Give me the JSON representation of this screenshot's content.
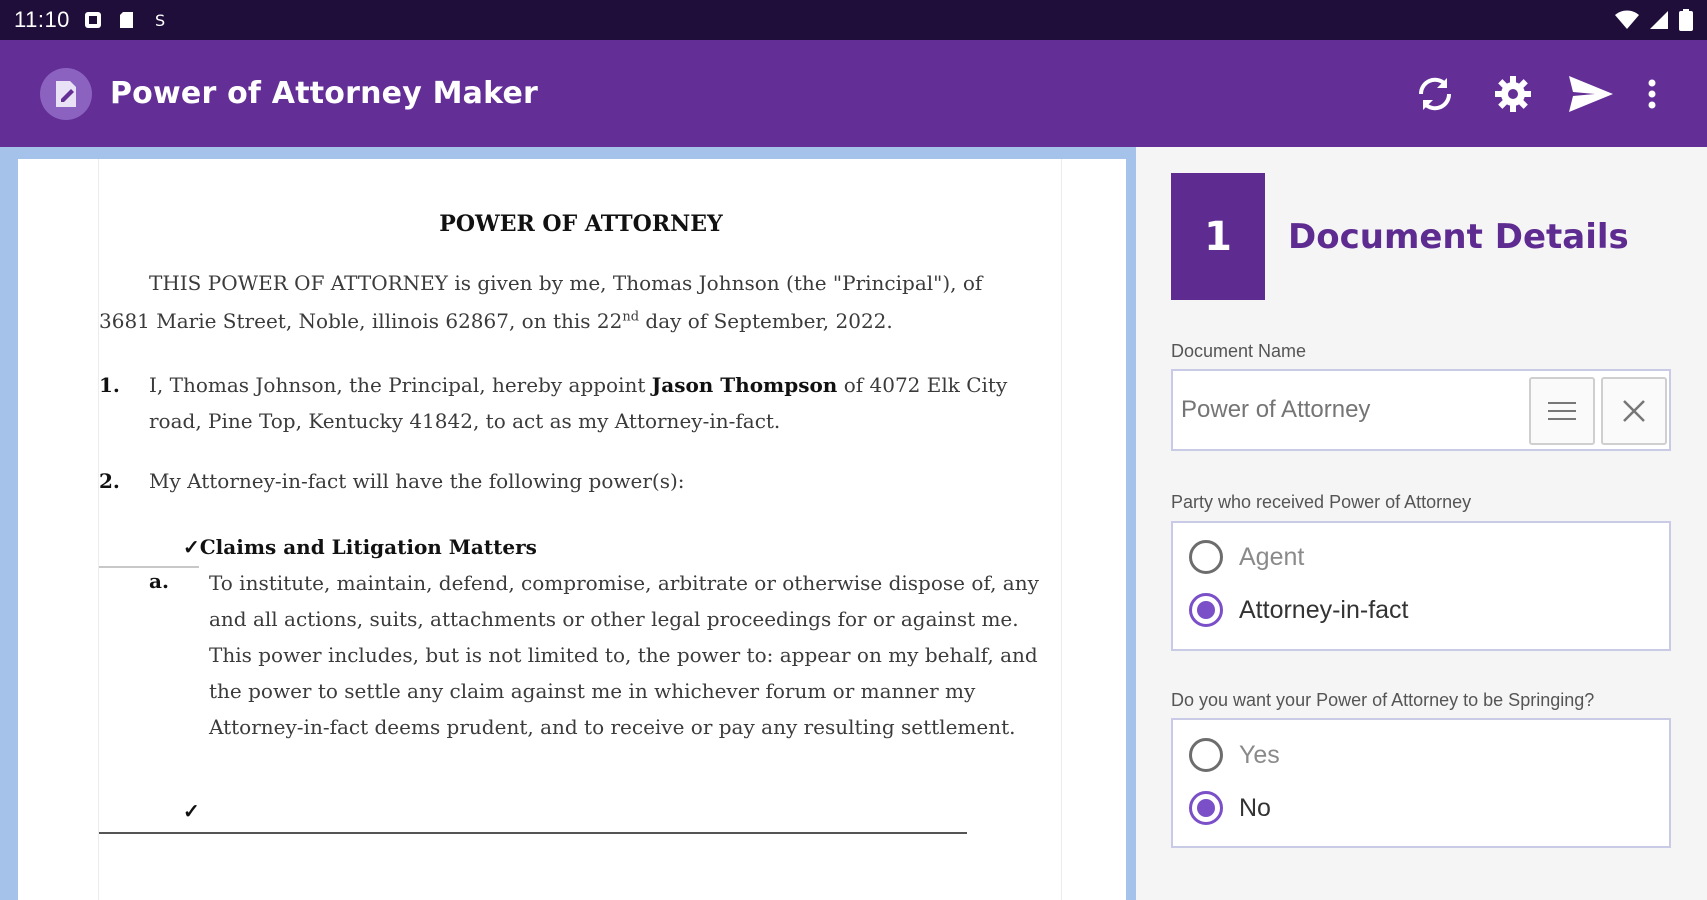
{
  "status_bar": {
    "time": "11:10",
    "icons": [
      "notification-icon",
      "sd-card-icon",
      "app-s-icon",
      "wifi-icon",
      "signal-icon",
      "battery-icon"
    ]
  },
  "app_bar": {
    "title": "Power of Attorney Maker",
    "actions": [
      "refresh-icon",
      "settings-icon",
      "send-icon",
      "more-vert-icon"
    ],
    "color": "#632f97"
  },
  "document": {
    "title": "POWER OF ATTORNEY",
    "intro_line1": "THIS POWER OF ATTORNEY is given by me, Thomas Johnson (the \"Principal\"), of",
    "intro_line2_pre": "3681 Marie Street, Noble, illinois 62867, on this 22",
    "intro_sup": "nd",
    "intro_line2_post": " day of September, 2022.",
    "item1_num": "1.",
    "item1_line1_pre": "I, Thomas Johnson, the Principal, hereby appoint ",
    "item1_agent": "Jason Thompson",
    "item1_line1_post": " of 4072 Elk City",
    "item1_line2": "road, Pine Top, Kentucky 41842, to act as my Attorney-in-fact.",
    "item2_num": "2.",
    "item2_text": "My Attorney-in-fact will have the following power(s):",
    "power_check": "✓",
    "power_title": "Claims and Litigation Matters",
    "power_a_label": "a.",
    "power_a_text": "To institute, maintain, defend, compromise, arbitrate or otherwise dispose of, any and all actions, suits, attachments or other legal proceedings for or against me. This power includes, but is not limited to, the power to: appear on my behalf, and the power to settle any claim against me in whichever forum or manner my Attorney-in-fact deems prudent, and to receive or pay any resulting settlement.",
    "next_check": "✓"
  },
  "form": {
    "step_number": "1",
    "section_title": "Document Details",
    "document_name_label": "Document Name",
    "document_name_placeholder": "Power of Attorney",
    "party_label": "Party who received Power of Attorney",
    "party_options": [
      {
        "label": "Agent",
        "selected": false
      },
      {
        "label": "Attorney-in-fact",
        "selected": true
      }
    ],
    "springing_label": "Do you want your Power of Attorney to be Springing?",
    "springing_options": [
      {
        "label": "Yes",
        "selected": false
      },
      {
        "label": "No",
        "selected": true
      }
    ],
    "accent_color": "#5e2c91"
  }
}
